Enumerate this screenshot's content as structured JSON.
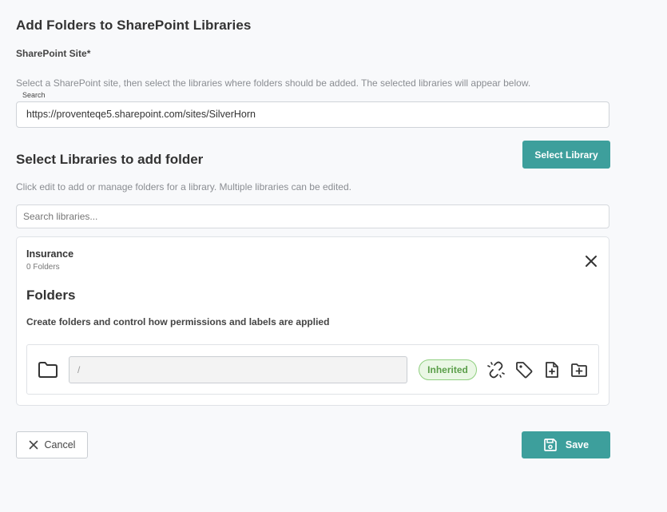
{
  "page": {
    "title": "Add Folders to SharePoint Libraries"
  },
  "site": {
    "label": "SharePoint Site*",
    "help": "Select a SharePoint site, then select the libraries where folders should be added. The selected libraries will appear below.",
    "search_label": "Search",
    "value": "https://proventeqe5.sharepoint.com/sites/SilverHorn"
  },
  "libraries": {
    "title": "Select Libraries to add folder",
    "select_button": "Select Library",
    "help": "Click edit to add or manage folders for a library. Multiple libraries can be edited.",
    "search_placeholder": "Search libraries...",
    "items": [
      {
        "name": "Insurance",
        "count": "0 Folders"
      }
    ]
  },
  "folders": {
    "title": "Folders",
    "help": "Create folders and control how permissions and labels are applied",
    "rows": [
      {
        "path": "/",
        "permission": "Inherited"
      }
    ],
    "icons": [
      "folder-icon",
      "unlink-icon",
      "tag-icon",
      "add-file-icon",
      "add-folder-icon"
    ]
  },
  "footer": {
    "cancel_label": "Cancel",
    "save_label": "Save"
  },
  "colors": {
    "accent": "#3d9f9c",
    "inherited_bg": "#eaf7e5",
    "inherited_text": "#5a9e49"
  }
}
